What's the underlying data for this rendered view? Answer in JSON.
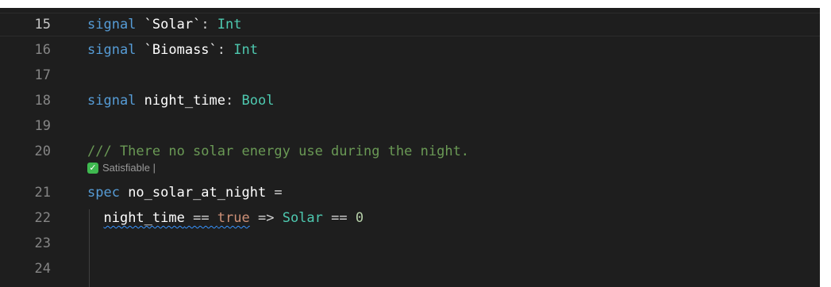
{
  "editor": {
    "lines": [
      {
        "num": "15",
        "current": true,
        "tokens": [
          {
            "t": "signal ",
            "c": "kw"
          },
          {
            "t": "`Solar`",
            "c": "id"
          },
          {
            "t": ": ",
            "c": "plain"
          },
          {
            "t": "Int",
            "c": "ty"
          }
        ]
      },
      {
        "num": "16",
        "current": false,
        "tokens": [
          {
            "t": "signal ",
            "c": "kw"
          },
          {
            "t": "`Biomass`",
            "c": "id"
          },
          {
            "t": ": ",
            "c": "plain"
          },
          {
            "t": "Int",
            "c": "ty"
          }
        ]
      },
      {
        "num": "17",
        "current": false,
        "tokens": []
      },
      {
        "num": "18",
        "current": false,
        "tokens": [
          {
            "t": "signal ",
            "c": "kw"
          },
          {
            "t": "night_time",
            "c": "id"
          },
          {
            "t": ": ",
            "c": "plain"
          },
          {
            "t": "Bool",
            "c": "ty"
          }
        ]
      },
      {
        "num": "19",
        "current": false,
        "tokens": []
      },
      {
        "num": "20",
        "current": false,
        "tokens": [
          {
            "t": "/// There no solar energy use during the night.",
            "c": "comment"
          }
        ]
      },
      {
        "num": "21",
        "current": false,
        "tokens": [
          {
            "t": "spec ",
            "c": "kw"
          },
          {
            "t": "no_solar_at_night",
            "c": "id"
          },
          {
            "t": " =",
            "c": "plain"
          }
        ]
      },
      {
        "num": "22",
        "current": false,
        "tokens": [
          {
            "t": "  ",
            "c": "plain"
          },
          {
            "t": "night_time",
            "c": "var",
            "squiggle": true
          },
          {
            "t": " == ",
            "c": "plain",
            "squiggle": true
          },
          {
            "t": "true",
            "c": "bool",
            "squiggle": true
          },
          {
            "t": " => ",
            "c": "plain"
          },
          {
            "t": "Solar",
            "c": "sig"
          },
          {
            "t": " == ",
            "c": "plain"
          },
          {
            "t": "0",
            "c": "num"
          }
        ]
      },
      {
        "num": "23",
        "current": false,
        "tokens": []
      },
      {
        "num": "24",
        "current": false,
        "tokens": []
      }
    ],
    "codelens": {
      "icon": "check-icon",
      "label": "Satisfiable |"
    }
  }
}
